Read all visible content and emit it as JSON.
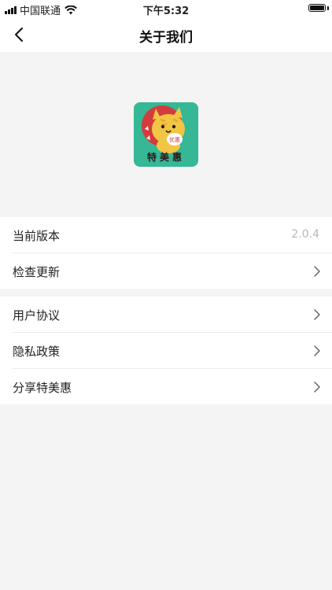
{
  "status_bar": {
    "carrier": "中国联通",
    "time": "下午5:32",
    "icons": [
      "signal-icon",
      "wifi-icon",
      "battery-icon"
    ]
  },
  "nav": {
    "title": "关于我们",
    "back_icon": "chevron-left-icon"
  },
  "logo": {
    "text": "特美惠",
    "badge": "优惠",
    "colors": {
      "background": "#36b796",
      "circle": "#d33c3c",
      "cat": "#f3c545"
    }
  },
  "group1": [
    {
      "label": "当前版本",
      "value": "2.0.4"
    },
    {
      "label": "检查更新",
      "icon": "chevron-right-icon"
    }
  ],
  "group2": [
    {
      "label": "用户协议",
      "icon": "chevron-right-icon"
    },
    {
      "label": "隐私政策",
      "icon": "chevron-right-icon"
    },
    {
      "label": "分享特美惠",
      "icon": "chevron-right-icon"
    }
  ]
}
